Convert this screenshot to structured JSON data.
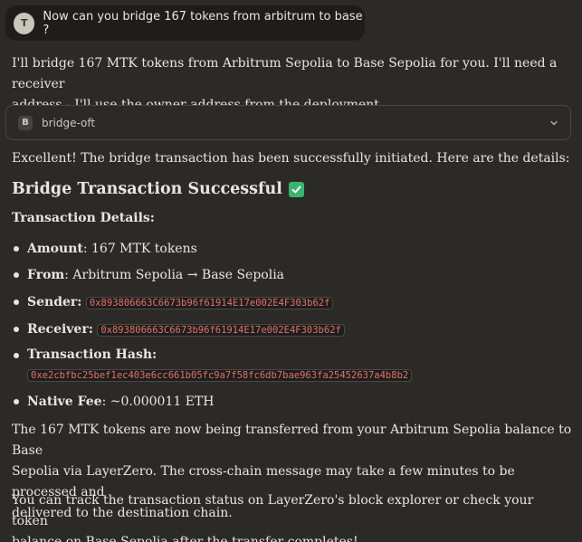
{
  "user_message": {
    "avatar_initial": "T",
    "text": "Now can you bridge 167 tokens from arbitrum to base ?"
  },
  "assistant": {
    "intro_line1": "I'll bridge 167 MTK tokens from Arbitrum Sepolia to Base Sepolia for you. I'll need a receiver",
    "intro_line2": "address - I'll use the owner address from the deployment.",
    "tool": {
      "badge": "B",
      "name": "bridge-oft",
      "icon": "chevron-down-icon"
    },
    "excellent": "Excellent! The bridge transaction has been successfully initiated. Here are the details:",
    "heading": "Bridge Transaction Successful",
    "heading_icon": "check-mark-icon",
    "subheading": "Transaction Details:",
    "details": {
      "amount_label": "Amount",
      "amount_value": ": 167 MTK tokens",
      "from_label": "From",
      "from_value": ": Arbitrum Sepolia → Base Sepolia",
      "sender_label": "Sender",
      "sender_value": "0x893806663C6673b96f61914E17e002E4F303b62f",
      "receiver_label": "Receiver",
      "receiver_value": "0x893806663C6673b96f61914E17e002E4F303b62f",
      "hash_label": "Transaction Hash",
      "hash_value": "0xe2cbfbc25bef1ec403e6cc661b05fc9a7f58fc6db7bae963fa25452637a4b8b2",
      "fee_label": "Native Fee",
      "fee_value": ": ~0.000011 ETH"
    },
    "closing_line1": "The 167 MTK tokens are now being transferred from your Arbitrum Sepolia balance to Base",
    "closing_line2": "Sepolia via LayerZero. The cross-chain message may take a few minutes to be processed and",
    "closing_line3": "delivered to the destination chain.",
    "track_line1": "You can track the transaction status on LayerZero's block explorer or check your token",
    "track_line2": "balance on Base Sepolia after the transfer completes!"
  },
  "colors": {
    "background": "#2b2a27",
    "code_text": "#e0726a",
    "check": "#3cb371"
  }
}
